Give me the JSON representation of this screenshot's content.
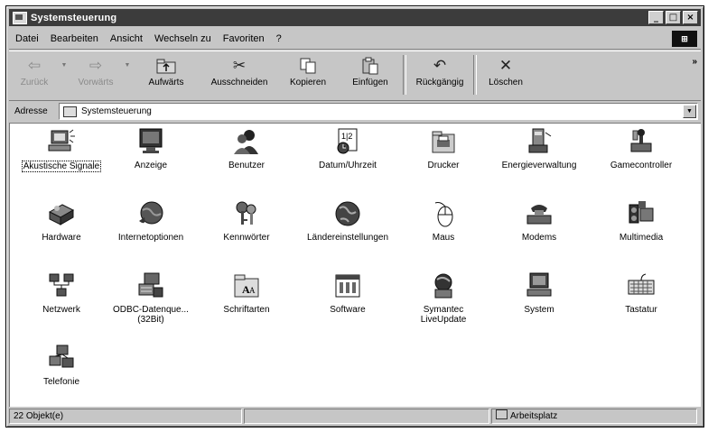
{
  "window": {
    "title": "Systemsteuerung",
    "controls": {
      "minimize": "_",
      "maximize": "□",
      "close": "×"
    }
  },
  "menu": {
    "items": [
      "Datei",
      "Bearbeiten",
      "Ansicht",
      "Wechseln zu",
      "Favoriten",
      "?"
    ],
    "logo_icon": "windows-logo-icon"
  },
  "toolbar": {
    "buttons": [
      {
        "label": "Zurück",
        "icon": "back-arrow-icon",
        "enabled": false
      },
      {
        "label": "Vorwärts",
        "icon": "forward-arrow-icon",
        "enabled": false
      },
      {
        "label": "Aufwärts",
        "icon": "up-folder-icon",
        "enabled": true
      },
      {
        "label": "Ausschneiden",
        "icon": "scissors-icon",
        "enabled": true
      },
      {
        "label": "Kopieren",
        "icon": "copy-icon",
        "enabled": true
      },
      {
        "label": "Einfügen",
        "icon": "paste-icon",
        "enabled": true
      },
      {
        "label": "Rückgängig",
        "icon": "undo-icon",
        "enabled": true
      },
      {
        "label": "Löschen",
        "icon": "delete-icon",
        "enabled": true
      }
    ],
    "more": "»"
  },
  "address": {
    "label": "Adresse",
    "value": "Systemsteuerung"
  },
  "items": [
    {
      "label": "Akustische Signale",
      "icon": "speaker-computer-icon",
      "selected": true
    },
    {
      "label": "Anzeige",
      "icon": "monitor-icon"
    },
    {
      "label": "Benutzer",
      "icon": "users-icon"
    },
    {
      "label": "Datum/Uhrzeit",
      "icon": "calendar-clock-icon"
    },
    {
      "label": "Drucker",
      "icon": "printers-folder-icon"
    },
    {
      "label": "Energieverwaltung",
      "icon": "power-management-icon"
    },
    {
      "label": "Gamecontroller",
      "icon": "joystick-icon"
    },
    {
      "label": "Hardware",
      "icon": "hardware-icon"
    },
    {
      "label": "Internetoptionen",
      "icon": "globe-icon"
    },
    {
      "label": "Kennwörter",
      "icon": "keys-icon"
    },
    {
      "label": "Ländereinstellungen",
      "icon": "world-globe-icon"
    },
    {
      "label": "Maus",
      "icon": "mouse-icon"
    },
    {
      "label": "Modems",
      "icon": "modem-icon"
    },
    {
      "label": "Multimedia",
      "icon": "multimedia-icon"
    },
    {
      "label": "Netzwerk",
      "icon": "network-icon"
    },
    {
      "label": "ODBC-Datenque...\n(32Bit)",
      "icon": "odbc-icon"
    },
    {
      "label": "Schriftarten",
      "icon": "fonts-folder-icon"
    },
    {
      "label": "Software",
      "icon": "software-icon"
    },
    {
      "label": "Symantec\nLiveUpdate",
      "icon": "liveupdate-icon"
    },
    {
      "label": "System",
      "icon": "computer-icon"
    },
    {
      "label": "Tastatur",
      "icon": "keyboard-icon"
    },
    {
      "label": "Telefonie",
      "icon": "telephony-icon"
    }
  ],
  "status": {
    "count": "22 Objekt(e)",
    "zone": "Arbeitsplatz"
  }
}
